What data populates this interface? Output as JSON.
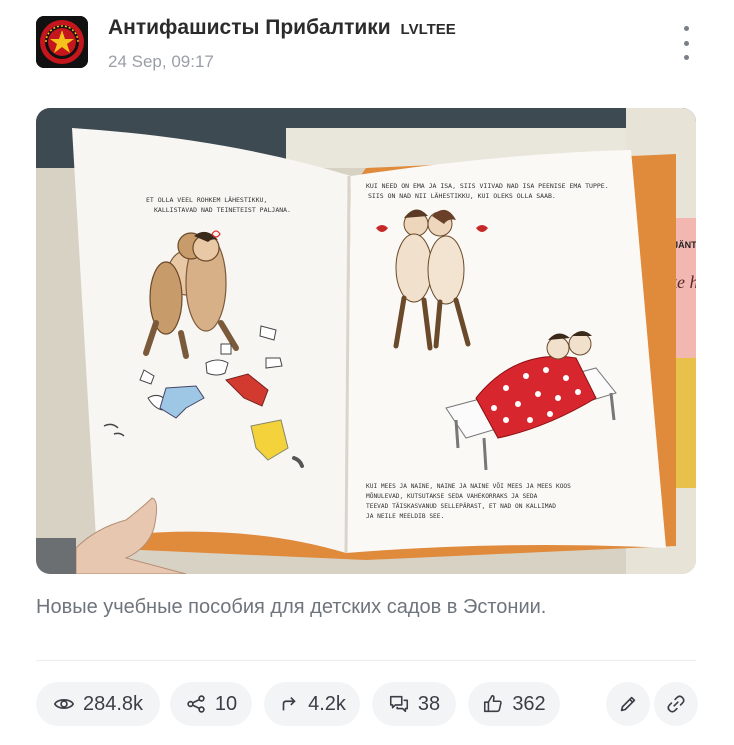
{
  "post": {
    "channel_name": "Антифашисты Прибалтики",
    "channel_tag": "LVLTEE",
    "timestamp": "24 Sep, 09:17",
    "avatar_icon": "red-star-emblem-icon",
    "caption": "Новые учебные пособия для детских садов в Эстонии."
  },
  "photo": {
    "left_page_text": "ET OLLA VEEL ROHKEM LÄHESTIKKU, KALLISTAVAD NAD TEINETEIST PALJANA.",
    "right_page_top_text": "KUI NEED ON EMA JA ISA, SIIS VIIVAD NAD ISA PEENISE EMA TUPPE. SIIS ON NAD NII LÄHESTIKKU, KUI OLEKS OLLA SAAB.",
    "right_page_bottom_text": "KUI MEES JA NAINE, NAINE JA NAINE VÕI MEES JA MEES KOOS MÕNULEVAD, KUTSUTAKSE SEDA VAHEKORRAKS JA SEDA TEEVAD TÄISKASVANUD SELLEPÄRAST, ET NAD ON KALLIMAD JA NEILE MEELDIB SEE.",
    "side_book_author": "RIIKKA JÄNTTI",
    "side_book_title": "Väike h... lab ma..."
  },
  "stats": {
    "views": "284.8k",
    "shares": "10",
    "forwards": "4.2k",
    "comments": "38",
    "likes": "362"
  },
  "colors": {
    "accent": "#2b2b2b",
    "muted": "#9a9fa6",
    "pill_bg": "#f3f4f6",
    "book_orange": "#e08a3c",
    "dots_red": "#d8262f"
  }
}
